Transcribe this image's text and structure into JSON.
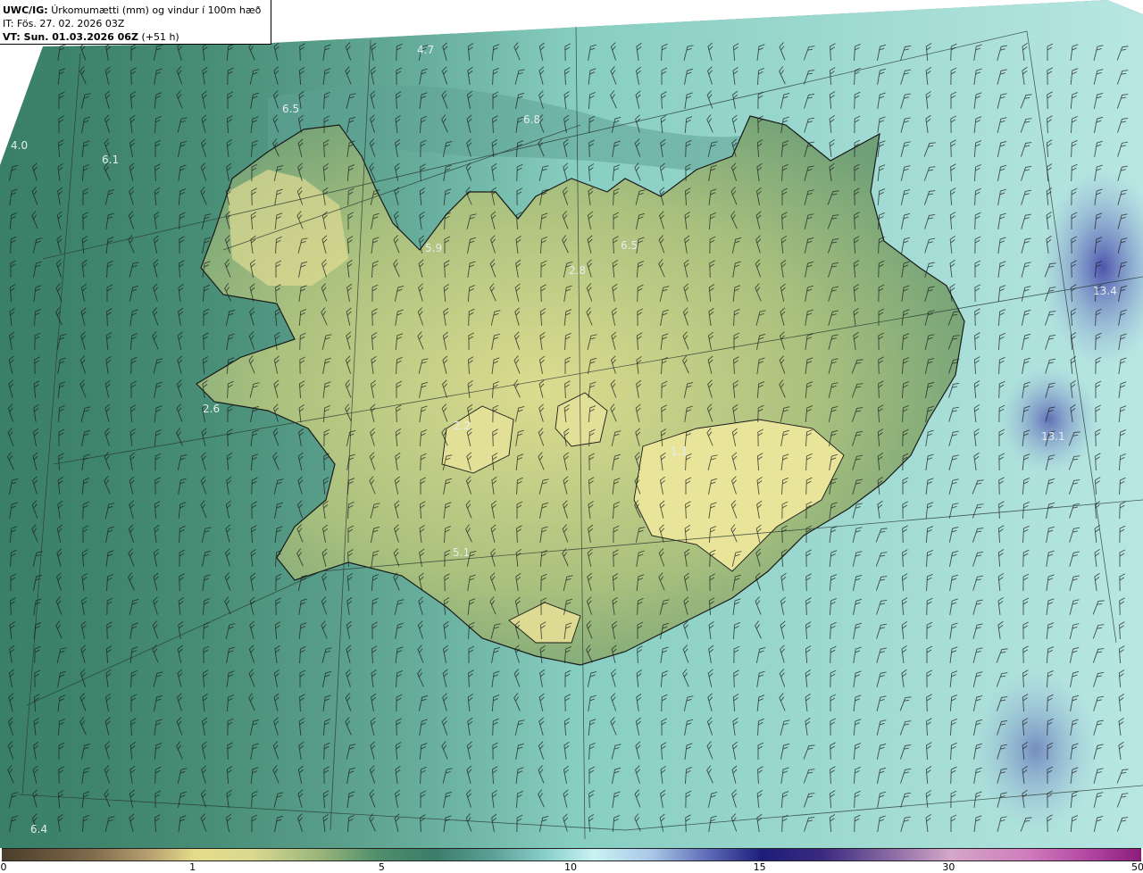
{
  "header": {
    "model": "UWC/IG:",
    "description": "Úrkomumætti (mm) og vindur í 100m hæð",
    "initial_time": "IT: Fös. 27. 02. 2026 03Z",
    "valid_time_label": "VT: Sun. 01.03.2026 06Z",
    "forecast_offset": "(+51 h)"
  },
  "map_values": [
    {
      "id": "v1",
      "text": "4.7"
    },
    {
      "id": "v2",
      "text": "6.5"
    },
    {
      "id": "v3",
      "text": "6.8"
    },
    {
      "id": "v4",
      "text": "4.0"
    },
    {
      "id": "v5",
      "text": "6.1"
    },
    {
      "id": "v6",
      "text": "5.9"
    },
    {
      "id": "v7",
      "text": "6.5"
    },
    {
      "id": "v8",
      "text": "2.8"
    },
    {
      "id": "v9",
      "text": "13.4"
    },
    {
      "id": "v10",
      "text": "2.6"
    },
    {
      "id": "v11",
      "text": "2.2"
    },
    {
      "id": "v12",
      "text": "1.1"
    },
    {
      "id": "v13",
      "text": "13.1"
    },
    {
      "id": "v14",
      "text": "5.1"
    },
    {
      "id": "v15",
      "text": "6.4"
    }
  ],
  "colorbar": {
    "ticks": [
      {
        "label": "0",
        "value": 0
      },
      {
        "label": "1",
        "value": 1
      },
      {
        "label": "5",
        "value": 5
      },
      {
        "label": "10",
        "value": 10
      },
      {
        "label": "15",
        "value": 15
      },
      {
        "label": "30",
        "value": 30
      },
      {
        "label": "50",
        "value": 50
      }
    ]
  },
  "colors": {
    "land_low": "#e8e59a",
    "sea_mid": "#3f8a6e",
    "sea_dark": "#2d6b5a",
    "light_cyan": "#bdf1ee",
    "blue_high": "#5a62b8"
  },
  "icons": [
    "wind-barb-icon"
  ]
}
